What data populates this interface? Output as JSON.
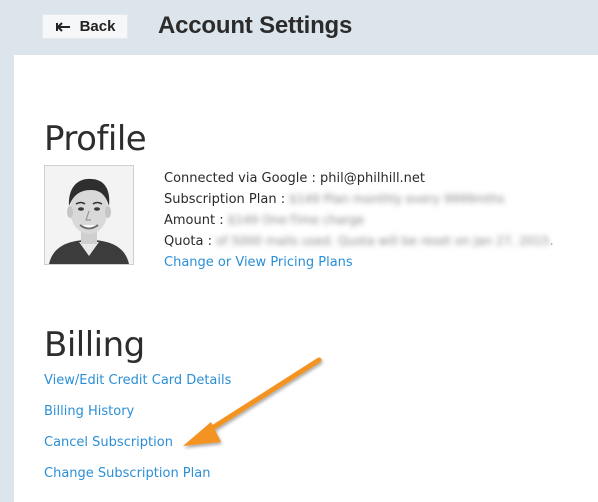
{
  "header": {
    "back_label": "Back",
    "title": "Account Settings"
  },
  "profile": {
    "heading": "Profile",
    "connected_prefix": "Connected via Google : ",
    "email": "phil@philhill.net",
    "plan_label": "Subscription Plan : ",
    "plan_value": "$149 Plan monthly every 9999mths",
    "amount_label": "Amount : ",
    "amount_value": "$149 One-Time charge",
    "quota_label": "Quota : ",
    "quota_value": "of 5000 mails used. Quota will be reset on Jan 27, 2015",
    "quota_trail": ".",
    "pricing_link": "Change or View Pricing Plans"
  },
  "billing": {
    "heading": "Billing",
    "links": [
      "View/Edit Credit Card Details",
      "Billing History",
      "Cancel Subscription",
      "Change Subscription Plan"
    ]
  },
  "colors": {
    "header_bg": "#dde5ec",
    "link": "#2b8fd6",
    "arrow": "#f39323"
  }
}
